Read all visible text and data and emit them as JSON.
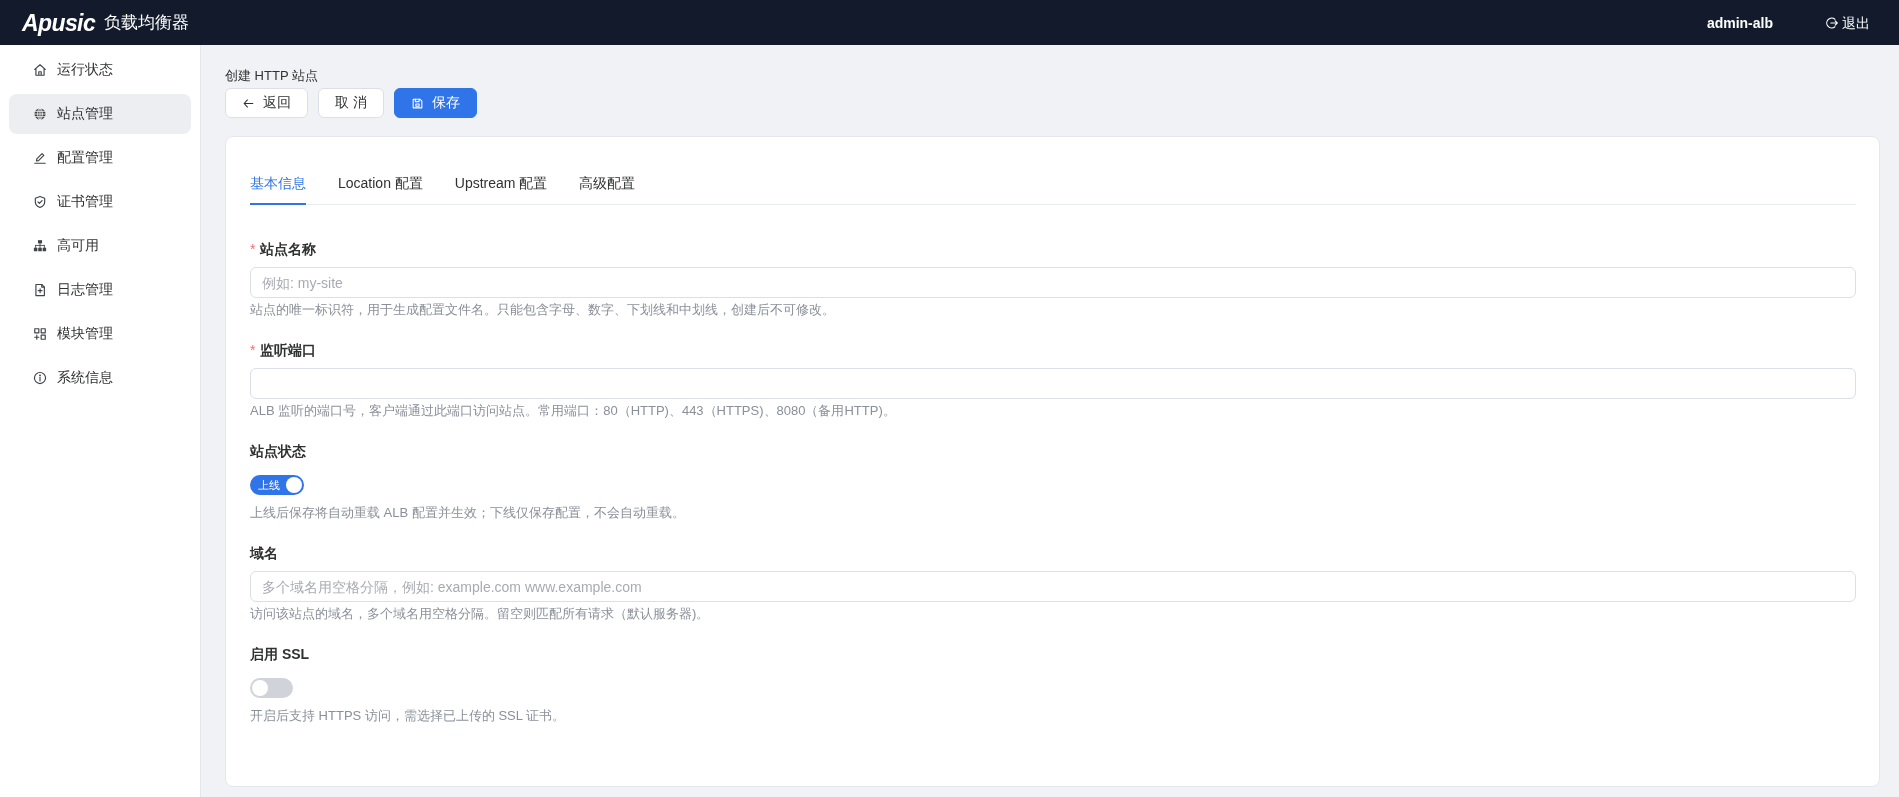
{
  "header": {
    "logo": "Apusic",
    "app_name": "负载均衡器",
    "user": "admin-alb",
    "logout": "退出"
  },
  "sidebar": {
    "items": [
      {
        "label": "运行状态",
        "selected": false
      },
      {
        "label": "站点管理",
        "selected": true
      },
      {
        "label": "配置管理",
        "selected": false
      },
      {
        "label": "证书管理",
        "selected": false
      },
      {
        "label": "高可用",
        "selected": false
      },
      {
        "label": "日志管理",
        "selected": false
      },
      {
        "label": "模块管理",
        "selected": false
      },
      {
        "label": "系统信息",
        "selected": false
      }
    ]
  },
  "page": {
    "title": "创建 HTTP 站点",
    "buttons": [
      {
        "label": "返回",
        "kind": "back"
      },
      {
        "label": "取 消",
        "kind": "default"
      },
      {
        "label": "保存",
        "kind": "primary"
      }
    ]
  },
  "tabs": [
    {
      "label": "基本信息",
      "selected": true
    },
    {
      "label": "Location 配置",
      "selected": false
    },
    {
      "label": "Upstream 配置",
      "selected": false
    },
    {
      "label": "高级配置",
      "selected": false
    }
  ],
  "form": {
    "fields": [
      {
        "kind": "input",
        "required_mark": "*",
        "label": "站点名称",
        "placeholder": "例如: my-site",
        "help": "站点的唯一标识符，用于生成配置文件名。只能包含字母、数字、下划线和中划线，创建后不可修改。"
      },
      {
        "kind": "input",
        "required_mark": "*",
        "label": "监听端口",
        "help": "ALB 监听的端口号，客户端通过此端口访问站点。常用端口：80（HTTP)、443（HTTPS)、8080（备用HTTP)。"
      },
      {
        "kind": "switch",
        "label": "站点状态",
        "on": true,
        "switch_text": "上线",
        "help": "上线后保存将自动重载 ALB 配置并生效；下线仅保存配置，不会自动重载。"
      },
      {
        "kind": "input",
        "label": "域名",
        "placeholder": "多个域名用空格分隔，例如: example.com www.example.com",
        "help": "访问该站点的域名，多个域名用空格分隔。留空则匹配所有请求（默认服务器)。"
      },
      {
        "kind": "switch",
        "label": "启用 SSL",
        "on": false,
        "help": "开启后支持 HTTPS 访问，需选择已上传的 SSL 证书。"
      }
    ]
  }
}
